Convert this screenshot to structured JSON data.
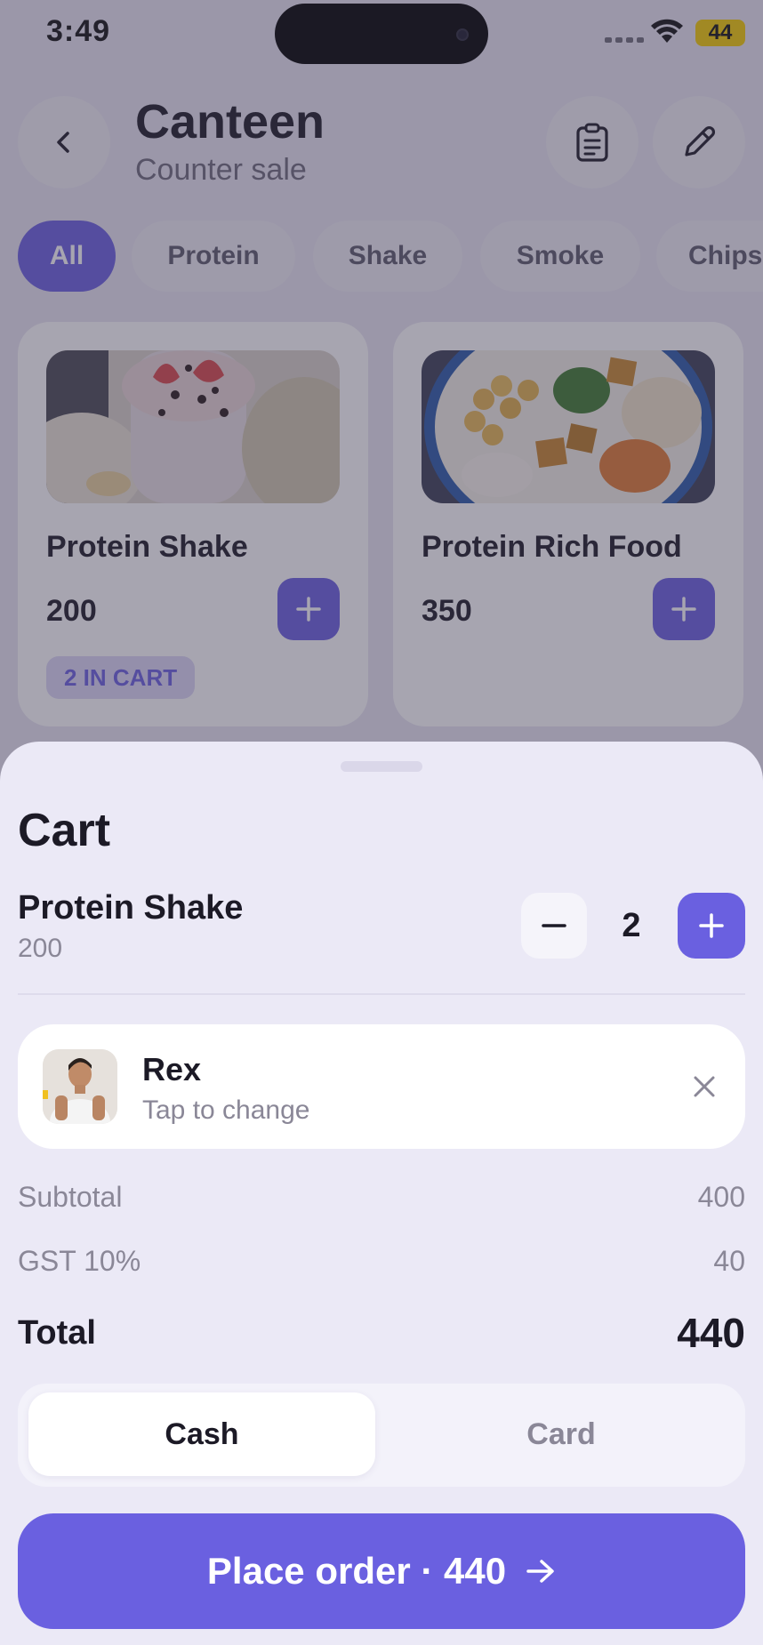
{
  "status_bar": {
    "time": "3:49",
    "battery": "44"
  },
  "header": {
    "title": "Canteen",
    "subtitle": "Counter sale"
  },
  "categories": [
    "All",
    "Protein",
    "Shake",
    "Smoke",
    "Chips"
  ],
  "products": [
    {
      "name": "Protein Shake",
      "price": "200",
      "badge": "2 IN CART"
    },
    {
      "name": "Protein Rich Food",
      "price": "350",
      "badge": ""
    }
  ],
  "cart": {
    "title": "Cart",
    "item": {
      "name": "Protein Shake",
      "price": "200",
      "quantity": "2"
    },
    "customer": {
      "name": "Rex",
      "hint": "Tap to change"
    },
    "subtotal_label": "Subtotal",
    "subtotal_value": "400",
    "gst_label": "GST 10%",
    "gst_value": "40",
    "total_label": "Total",
    "total_value": "440",
    "payment": {
      "cash": "Cash",
      "card": "Card",
      "selected": "Cash"
    },
    "place_order_label": "Place order · 440"
  },
  "colors": {
    "accent": "#6a60e0",
    "sheet_bg": "#ebe9f6",
    "battery": "#f5cc00"
  }
}
